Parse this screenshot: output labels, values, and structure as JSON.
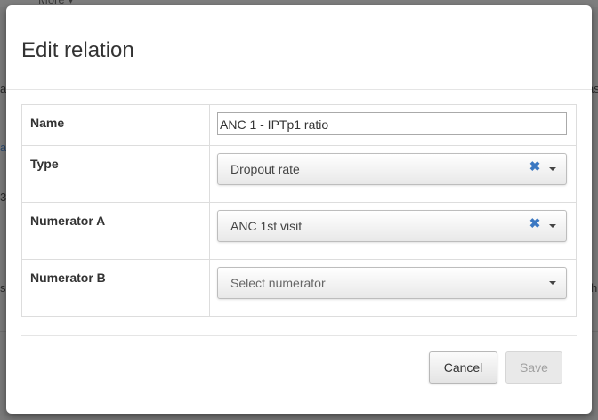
{
  "background": {
    "more_label": "More ▾",
    "fragments": [
      "a",
      "a",
      "3",
      "s",
      "as",
      "h"
    ]
  },
  "modal": {
    "title": "Edit relation",
    "fields": {
      "name": {
        "label": "Name",
        "value": "ANC 1 - IPTp1 ratio"
      },
      "type": {
        "label": "Type",
        "value": "Dropout rate",
        "clear_icon": "close-icon"
      },
      "numerator_a": {
        "label": "Numerator A",
        "value": "ANC 1st visit",
        "clear_icon": "close-icon"
      },
      "numerator_b": {
        "label": "Numerator B",
        "placeholder": "Select numerator"
      }
    },
    "buttons": {
      "cancel": "Cancel",
      "save": "Save"
    }
  },
  "colors": {
    "accent": "#3b78c2",
    "overlay": "#6b6b6b"
  }
}
